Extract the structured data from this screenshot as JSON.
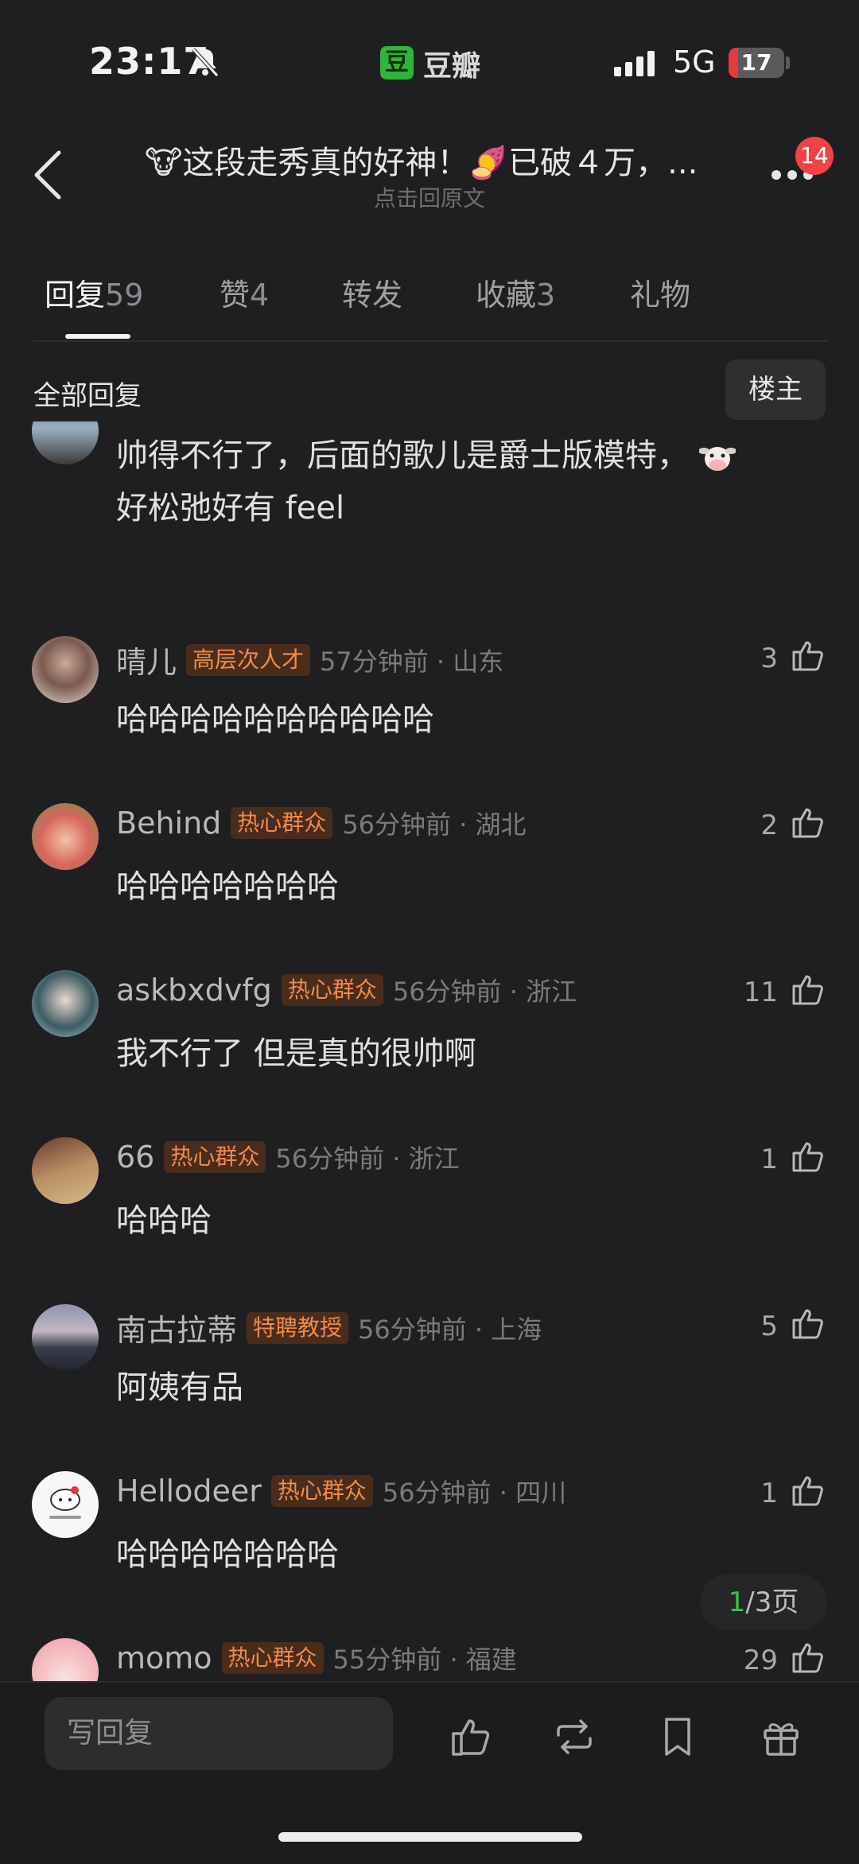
{
  "status_bar": {
    "time": "23:17",
    "app_badge": "豆",
    "app_name": "豆瓣",
    "network": "5G",
    "battery": "17",
    "battery_level": 0.17
  },
  "header": {
    "title": "🐮这段走秀真的好神！🍠已破４万，...",
    "subtitle": "点击回原文",
    "notification_count": "14"
  },
  "tabs": [
    {
      "label": "回复",
      "count": "59"
    },
    {
      "label": "赞",
      "count": "4"
    },
    {
      "label": "转发",
      "count": ""
    },
    {
      "label": "收藏",
      "count": "3"
    },
    {
      "label": "礼物",
      "count": ""
    }
  ],
  "filter": {
    "label": "全部回复",
    "owner_button": "楼主"
  },
  "comments": [
    {
      "user": "",
      "tag": "",
      "time": "",
      "likes": "",
      "text": "帅得不行了，后面的歌儿是爵士版模特，",
      "text2": "好松弛好有 feel"
    },
    {
      "user": "晴儿",
      "tag": "高层次人才",
      "time": "57分钟前 · 山东",
      "likes": "3",
      "text": "哈哈哈哈哈哈哈哈哈哈"
    },
    {
      "user": "Behind",
      "tag": "热心群众",
      "time": "56分钟前 · 湖北",
      "likes": "2",
      "text": "哈哈哈哈哈哈哈"
    },
    {
      "user": "askbxdvfg",
      "tag": "热心群众",
      "time": "56分钟前 · 浙江",
      "likes": "11",
      "text": "我不行了 但是真的很帅啊"
    },
    {
      "user": "66",
      "tag": "热心群众",
      "time": "56分钟前 · 浙江",
      "likes": "1",
      "text": "哈哈哈"
    },
    {
      "user": "南古拉蒂",
      "tag": "特聘教授",
      "time": "56分钟前 · 上海",
      "likes": "5",
      "text": "阿姨有品"
    },
    {
      "user": "Hellodeer",
      "tag": "热心群众",
      "time": "56分钟前 · 四川",
      "likes": "1",
      "text": "哈哈哈哈哈哈哈"
    },
    {
      "user": "momo",
      "tag": "热心群众",
      "time": "55分钟前 · 福建",
      "likes": "29",
      "text": ""
    }
  ],
  "pager": {
    "current": "1",
    "rest": "/3页"
  },
  "bottom_bar": {
    "reply_placeholder": "写回复"
  },
  "colors": {
    "background": "#1f1f21",
    "tag_bg": "#4a2c1c",
    "tag_text": "#ef8c4a",
    "pager_current": "#3fbf4b",
    "badge": "#f04444"
  }
}
